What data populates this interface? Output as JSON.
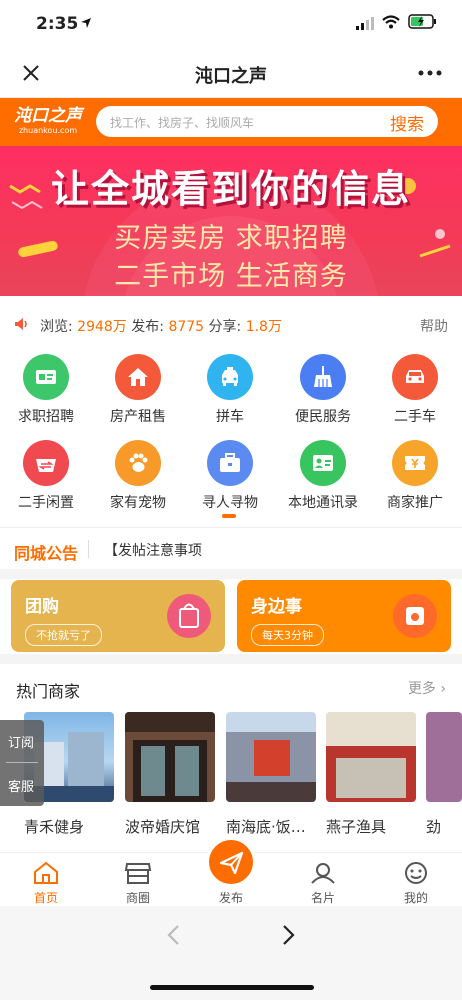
{
  "status": {
    "time": "2:35"
  },
  "nav": {
    "title": "沌口之声"
  },
  "header": {
    "logo_main": "沌口之声",
    "logo_sub": "zhuankou.com",
    "search_placeholder": "找工作、找房子、找顺风车",
    "search_button": "搜索"
  },
  "banner": {
    "line1": "让全城看到你的信息",
    "line2": "买房卖房  求职招聘",
    "line3": "二手市场  生活商务"
  },
  "stats": {
    "views_label": "浏览:",
    "views": "2948万",
    "posts_label": "发布:",
    "posts": "8775",
    "shares_label": "分享:",
    "shares": "1.8万",
    "help": "帮助"
  },
  "categories": [
    {
      "label": "求职招聘",
      "icon": "id-card-icon",
      "color": "#3ec76a"
    },
    {
      "label": "房产租售",
      "icon": "house-icon",
      "color": "#f45a3a"
    },
    {
      "label": "拼车",
      "icon": "car-icon",
      "color": "#2fb4f0"
    },
    {
      "label": "便民服务",
      "icon": "broom-icon",
      "color": "#4b7ef2"
    },
    {
      "label": "二手车",
      "icon": "car-front-icon",
      "color": "#f45a3a"
    },
    {
      "label": "二手闲置",
      "icon": "basket-icon",
      "color": "#f0494f"
    },
    {
      "label": "家有宠物",
      "icon": "paw-icon",
      "color": "#f79a2a"
    },
    {
      "label": "寻人寻物",
      "icon": "briefcase-icon",
      "color": "#5b8af0"
    },
    {
      "label": "本地通讯录",
      "icon": "contact-card-icon",
      "color": "#38c45e"
    },
    {
      "label": "商家推广",
      "icon": "ticket-icon",
      "color": "#f7a42a"
    }
  ],
  "notice": {
    "title": "同城公告",
    "message": "【发帖注意事项"
  },
  "promo": [
    {
      "title": "团购",
      "tag": "不抢就亏了",
      "bg": "#e6b44e",
      "circle": "#f05a7a"
    },
    {
      "title": "身边事",
      "tag": "每天3分钟",
      "bg": "#ff8a00",
      "circle": "#ff6a2a"
    }
  ],
  "hot": {
    "title": "热门商家",
    "more": "更多",
    "merchants": [
      {
        "name": "青禾健身"
      },
      {
        "name": "波帝婚庆馆"
      },
      {
        "name": "南海底·饭…"
      },
      {
        "name": "燕子渔具"
      },
      {
        "name": "劲"
      }
    ]
  },
  "side": {
    "subscribe": "订阅",
    "service": "客服"
  },
  "tabbar": {
    "home": "首页",
    "circle": "商圈",
    "publish": "发布",
    "card": "名片",
    "mine": "我的"
  }
}
